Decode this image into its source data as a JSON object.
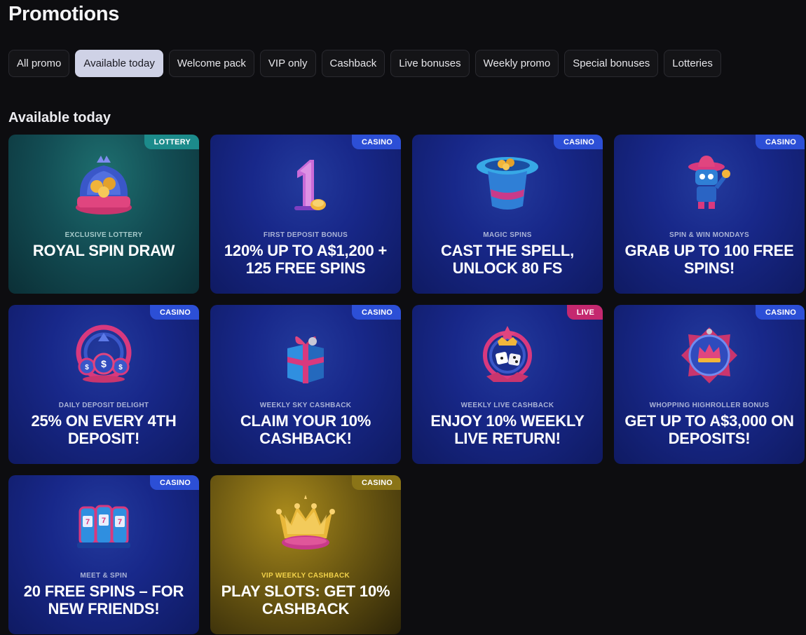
{
  "page": {
    "title": "Promotions"
  },
  "filters": [
    {
      "label": "All promo",
      "active": false
    },
    {
      "label": "Available today",
      "active": true
    },
    {
      "label": "Welcome pack",
      "active": false
    },
    {
      "label": "VIP only",
      "active": false
    },
    {
      "label": "Cashback",
      "active": false
    },
    {
      "label": "Live bonuses",
      "active": false
    },
    {
      "label": "Weekly promo",
      "active": false
    },
    {
      "label": "Special bonuses",
      "active": false
    },
    {
      "label": "Lotteries",
      "active": false
    }
  ],
  "section": {
    "title": "Available today"
  },
  "cards": [
    {
      "badge": "LOTTERY",
      "subtitle": "EXCLUSIVE LOTTERY",
      "title": "ROYAL SPIN DRAW",
      "icon": "lottery-crown-icon"
    },
    {
      "badge": "CASINO",
      "subtitle": "FIRST DEPOSIT BONUS",
      "title": "120% UP TO A$1,200 + 125 FREE SPINS",
      "icon": "number-one-coin-icon"
    },
    {
      "badge": "CASINO",
      "subtitle": "MAGIC SPINS",
      "title": "CAST THE SPELL, UNLOCK 80 FS",
      "icon": "magic-hat-icon"
    },
    {
      "badge": "CASINO",
      "subtitle": "SPIN & WIN MONDAYS",
      "title": "GRAB UP TO 100 FREE SPINS!",
      "icon": "cowboy-robot-icon"
    },
    {
      "badge": "CASINO",
      "subtitle": "DAILY DEPOSIT DELIGHT",
      "title": "25% ON EVERY 4TH DEPOSIT!",
      "icon": "dollar-chips-icon"
    },
    {
      "badge": "CASINO",
      "subtitle": "WEEKLY SKY CASHBACK",
      "title": "CLAIM YOUR 10% CASHBACK!",
      "icon": "gift-box-icon"
    },
    {
      "badge": "LIVE",
      "subtitle": "WEEKLY LIVE CASHBACK",
      "title": "ENJOY 10% WEEKLY LIVE RETURN!",
      "icon": "dice-emblem-icon"
    },
    {
      "badge": "CASINO",
      "subtitle": "WHOPPING HIGHROLLER BONUS",
      "title": "GET UP TO A$3,000 ON DEPOSITS!",
      "icon": "crown-shield-icon"
    },
    {
      "badge": "CASINO",
      "subtitle": "MEET & SPIN",
      "title": "20 FREE SPINS – FOR NEW FRIENDS!",
      "icon": "slot-machines-icon"
    },
    {
      "badge": "CASINO",
      "subtitle": "VIP WEEKLY CASHBACK",
      "title": "PLAY SLOTS: GET 10% CASHBACK",
      "icon": "gold-crown-icon"
    }
  ],
  "colors": {
    "background": "#0d0d10",
    "casino_badge": "#2c4fd6",
    "lottery_badge": "#1c8b8b",
    "live_badge": "#c4286f",
    "vip_accent": "#f2d24a"
  }
}
